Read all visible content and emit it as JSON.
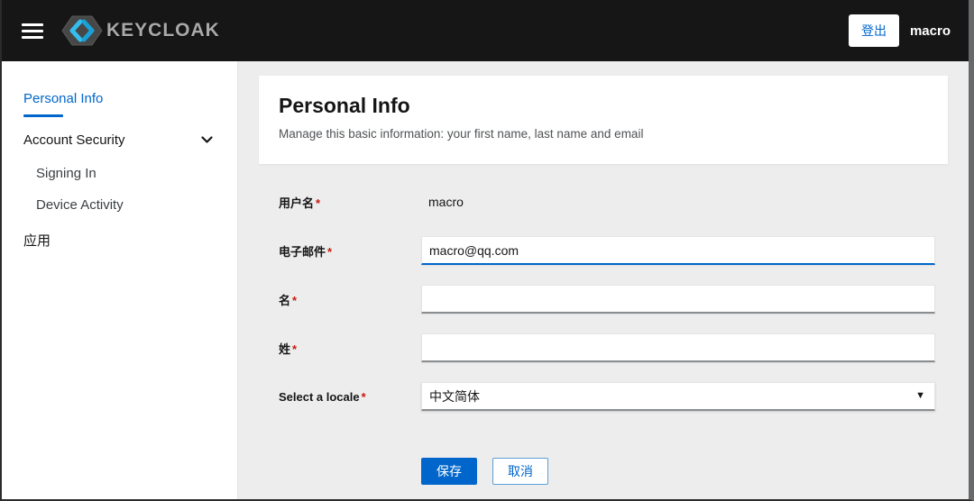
{
  "header": {
    "logo_text": "KEYCLOAK",
    "logout_label": "登出",
    "username": "macro"
  },
  "icons": {
    "menu": "hamburger-icon",
    "logo_mark": "keycloak-hexagon-icon",
    "account_security_expander": "chevron-down-icon",
    "locale_dropdown": "caret-down-icon"
  },
  "sidebar": {
    "items": [
      {
        "label": "Personal Info",
        "active": true
      },
      {
        "label": "Account Security",
        "expandable": true
      },
      {
        "label": "Signing In",
        "sub_item": true
      },
      {
        "label": "Device Activity",
        "sub_item": true
      },
      {
        "label": "应用"
      }
    ]
  },
  "main": {
    "title": "Personal Info",
    "subtitle": "Manage this basic information: your first name, last name and email",
    "form": {
      "username": {
        "label": "用户名",
        "required_marker": "*",
        "value": "macro"
      },
      "email": {
        "label": "电子邮件",
        "required_marker": "*",
        "value": "macro@qq.com"
      },
      "first_name": {
        "label": "名",
        "required_marker": "*",
        "value": ""
      },
      "last_name": {
        "label": "姓",
        "required_marker": "*",
        "value": ""
      },
      "locale": {
        "label": "Select a locale",
        "required_marker": "*",
        "value": "中文简体"
      }
    },
    "actions": {
      "save": "保存",
      "cancel": "取消"
    }
  },
  "colors": {
    "accent_blue": "#0066cc",
    "header_bg": "#161616",
    "required_red": "#c9190b",
    "content_bg": "#ededed",
    "logo_blue_light": "#35bdee",
    "logo_blue_dark": "#1a9fd6"
  }
}
